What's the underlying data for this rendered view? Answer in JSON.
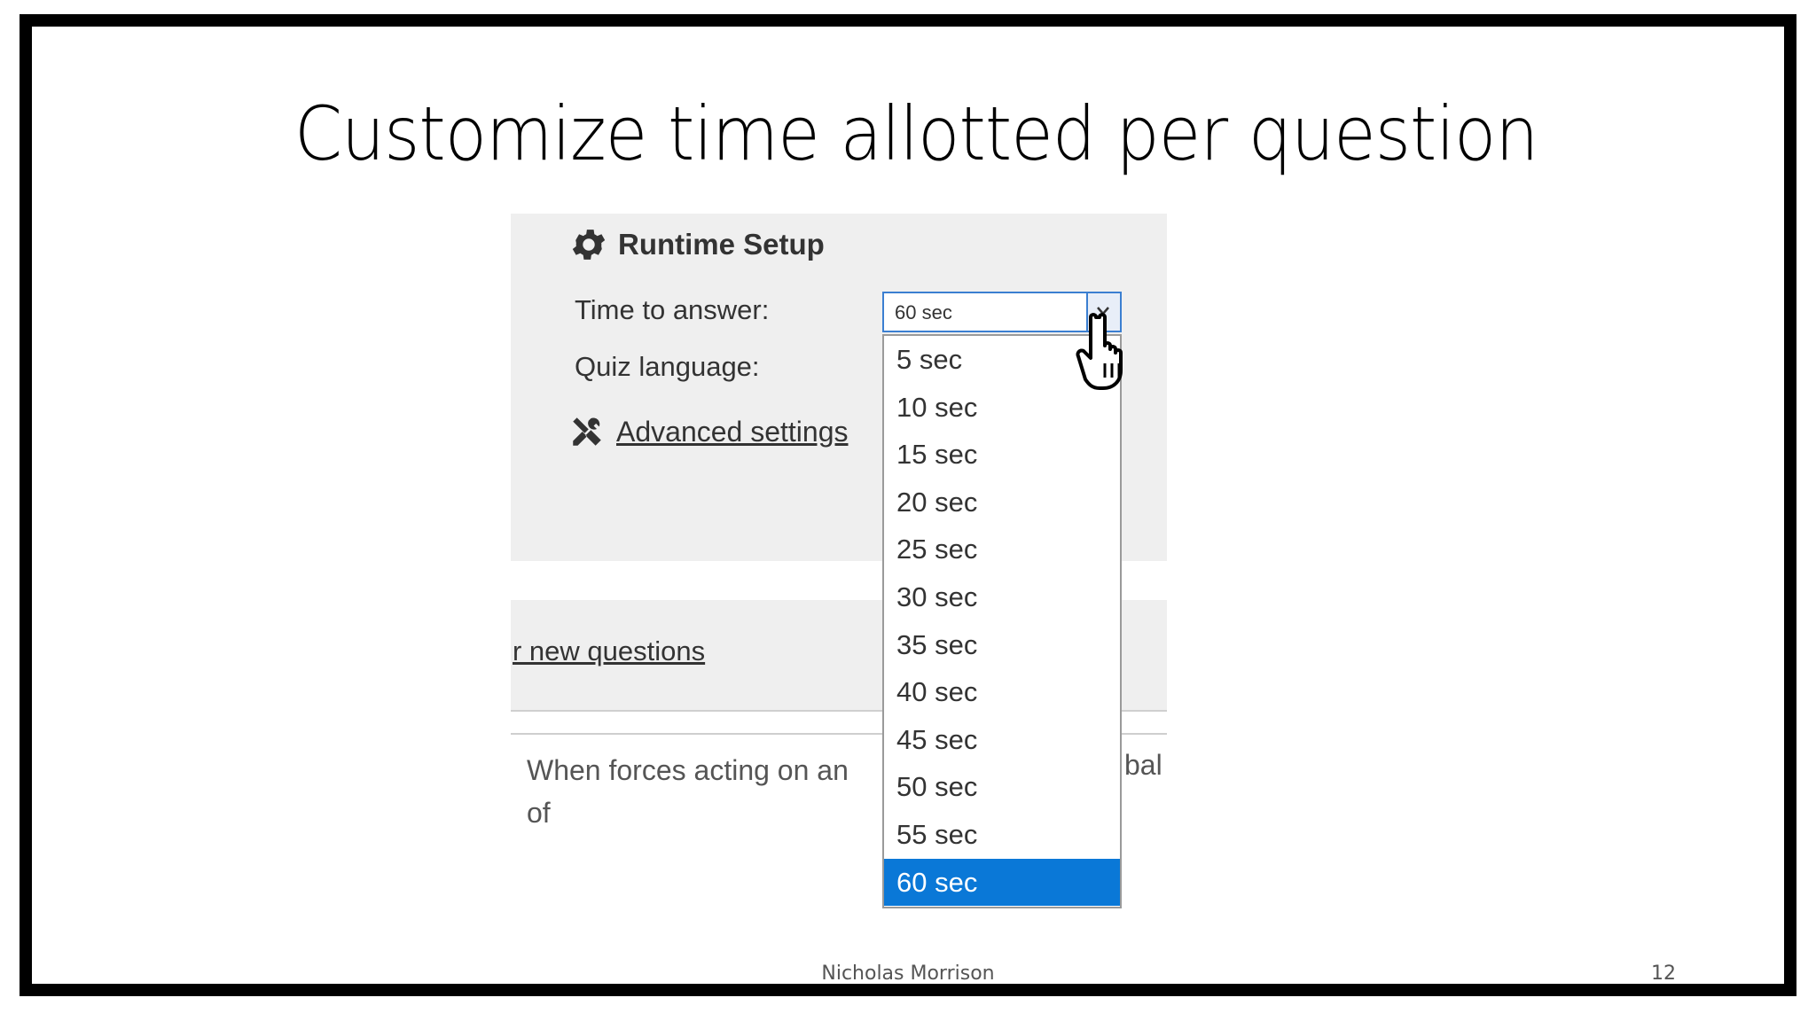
{
  "slide": {
    "title": "Customize time allotted per question",
    "footer_author": "Nicholas Morrison",
    "page_number": "12"
  },
  "runtime_setup": {
    "heading": "Runtime Setup",
    "heading_icon": "gear-icon",
    "time_label": "Time to answer:",
    "language_label": "Quiz language:",
    "time_select_value": "60 sec",
    "advanced_settings_label": "Advanced settings",
    "advanced_icon": "tools-icon"
  },
  "background_content": {
    "new_questions_link": "r new questions",
    "question_text": "When forces acting on an",
    "question_text_tail": "bal",
    "question_text_line2": "of"
  },
  "dropdown": {
    "options": [
      "5 sec",
      "10 sec",
      "15 sec",
      "20 sec",
      "25 sec",
      "30 sec",
      "35 sec",
      "40 sec",
      "45 sec",
      "50 sec",
      "55 sec",
      "60 sec"
    ],
    "selected_index": 11,
    "selected_color": "#0a78d7"
  },
  "cursor": {
    "icon": "hand-pointer-icon"
  }
}
